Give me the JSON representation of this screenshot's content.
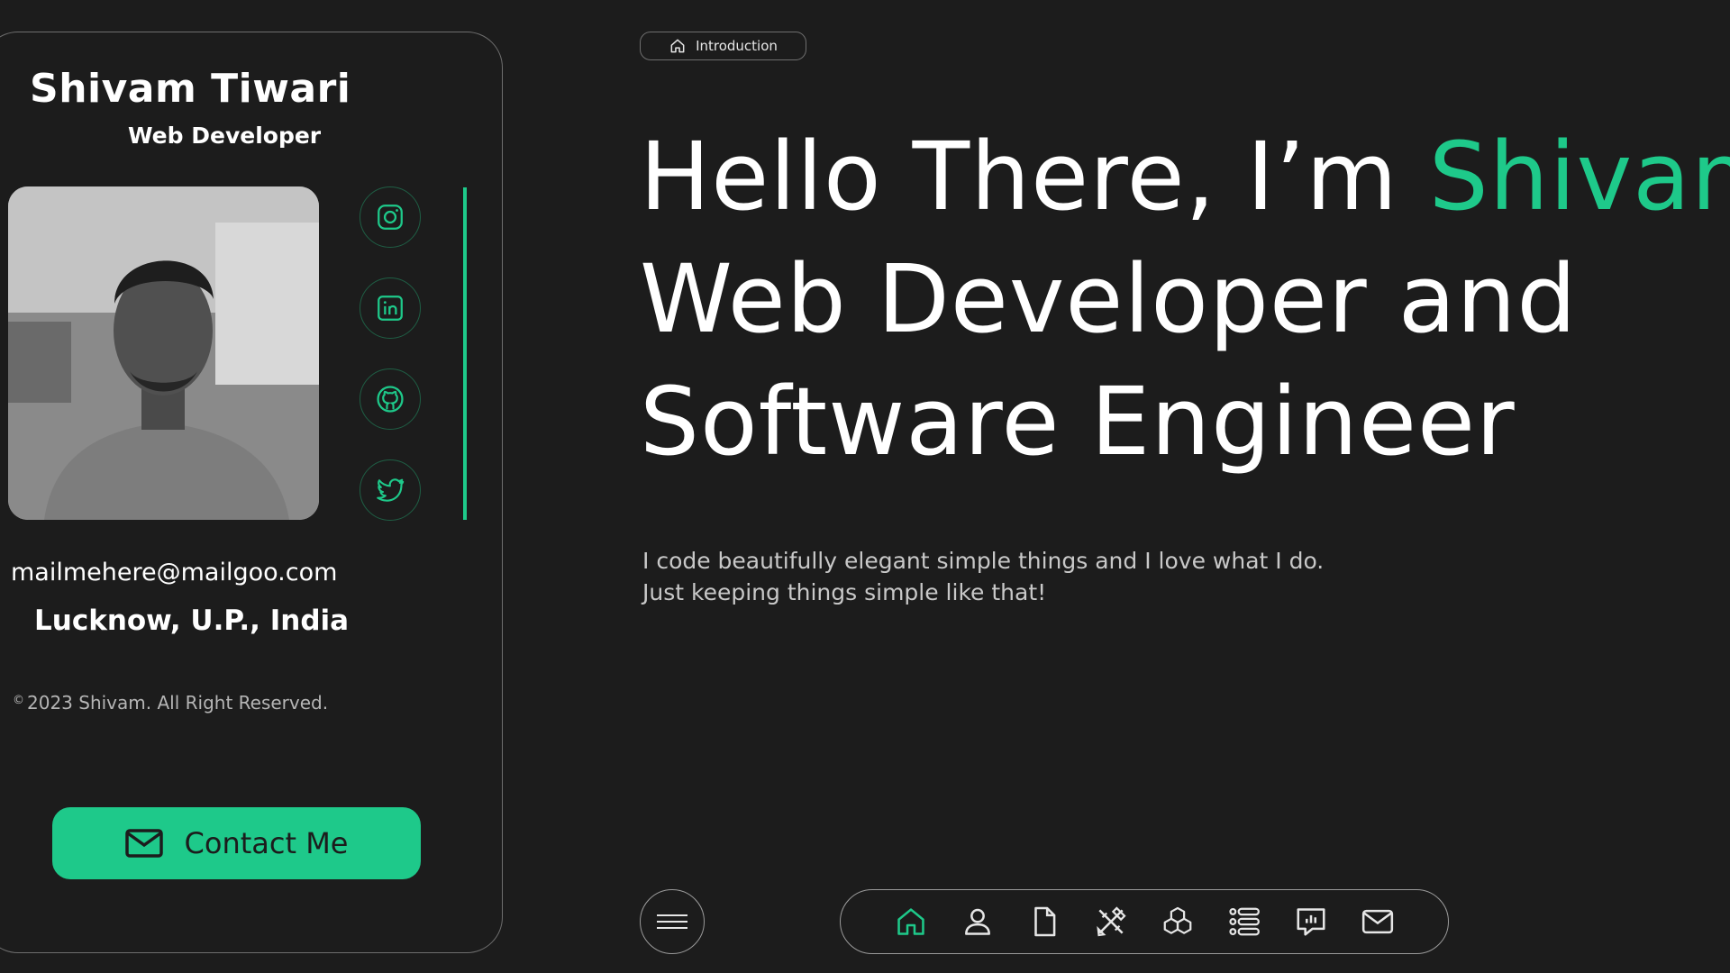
{
  "profile": {
    "name": "Shivam Tiwari",
    "role": "Web Developer",
    "email": "mailmehere@mailgoo.com",
    "location": "Lucknow, U.P., India",
    "copyright_symbol": "©",
    "copyright": "2023 Shivam. All Right Reserved.",
    "contact_label": "Contact Me",
    "social": [
      "instagram-icon",
      "linkedin-icon",
      "github-icon",
      "twitter-icon"
    ]
  },
  "intro_chip": {
    "label": "Introduction",
    "icon": "home-icon"
  },
  "hero": {
    "line1_prefix": "Hello There, I’m ",
    "line1_accent": "Shivam,",
    "line2": "Web Developer and",
    "line3": "Software Engineer"
  },
  "tagline": {
    "line1": "I code beautifully elegant simple things and I love what I do.",
    "line2": "Just keeping things simple like that!"
  },
  "nav": {
    "menu_icon": "hamburger-icon",
    "items": [
      "home-icon",
      "user-icon",
      "resume-icon",
      "services-icon",
      "skills-icon",
      "portfolio-icon",
      "testimonials-icon",
      "mail-icon"
    ],
    "active": "home-icon"
  },
  "colors": {
    "background": "#1c1c1c",
    "accent": "#1ec98a",
    "border": "#6e6e6e",
    "text": "#ffffff",
    "muted": "#c8c8c8"
  }
}
